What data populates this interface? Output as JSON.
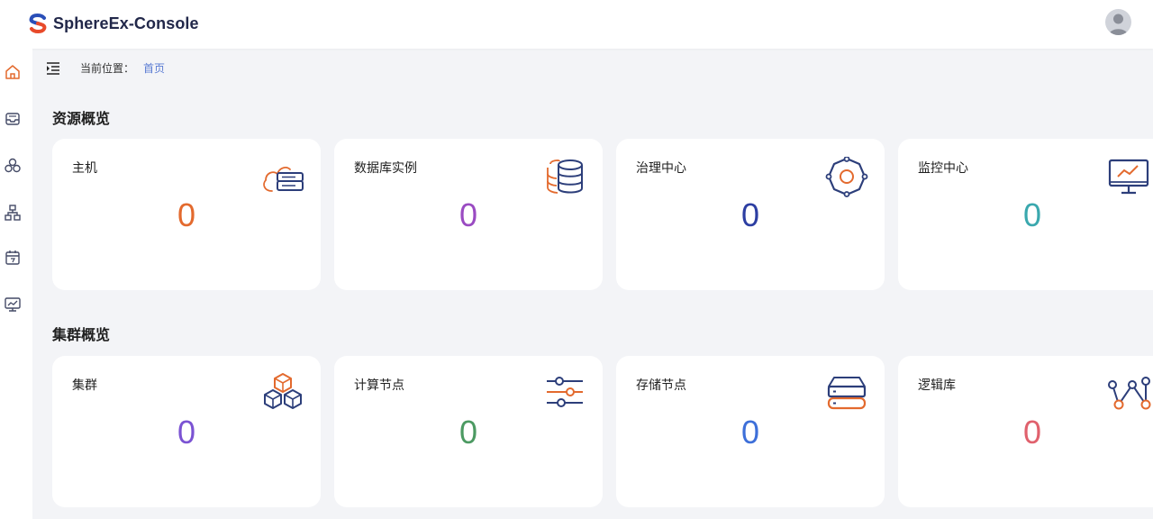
{
  "app": {
    "title": "SphereEx-Console"
  },
  "breadcrumb": {
    "label": "当前位置：",
    "current": "首页"
  },
  "sections": [
    {
      "title": "资源概览",
      "cards": [
        {
          "title": "主机",
          "value": "0",
          "color": "#e36a2e",
          "icon": "cloud-server-icon"
        },
        {
          "title": "数据库实例",
          "value": "0",
          "color": "#9a4bc2",
          "icon": "database-icon"
        },
        {
          "title": "治理中心",
          "value": "0",
          "color": "#2c3ea2",
          "icon": "gear-icon"
        },
        {
          "title": "监控中心",
          "value": "0",
          "color": "#3aa8ae",
          "icon": "monitor-icon"
        }
      ]
    },
    {
      "title": "集群概览",
      "cards": [
        {
          "title": "集群",
          "value": "0",
          "color": "#7b53d3",
          "icon": "cubes-icon"
        },
        {
          "title": "计算节点",
          "value": "0",
          "color": "#4c9a62",
          "icon": "sliders-icon"
        },
        {
          "title": "存储节点",
          "value": "0",
          "color": "#3d6fd9",
          "icon": "storage-icon"
        },
        {
          "title": "逻辑库",
          "value": "0",
          "color": "#e0616d",
          "icon": "nodes-graph-icon"
        }
      ]
    }
  ],
  "sidebar": {
    "items": [
      "home-icon",
      "inbox-icon",
      "cluster-icon",
      "topology-icon",
      "calendar-icon",
      "monitor-icon"
    ]
  },
  "colors": {
    "accent": "#e36a2e",
    "navy": "#22284a"
  }
}
